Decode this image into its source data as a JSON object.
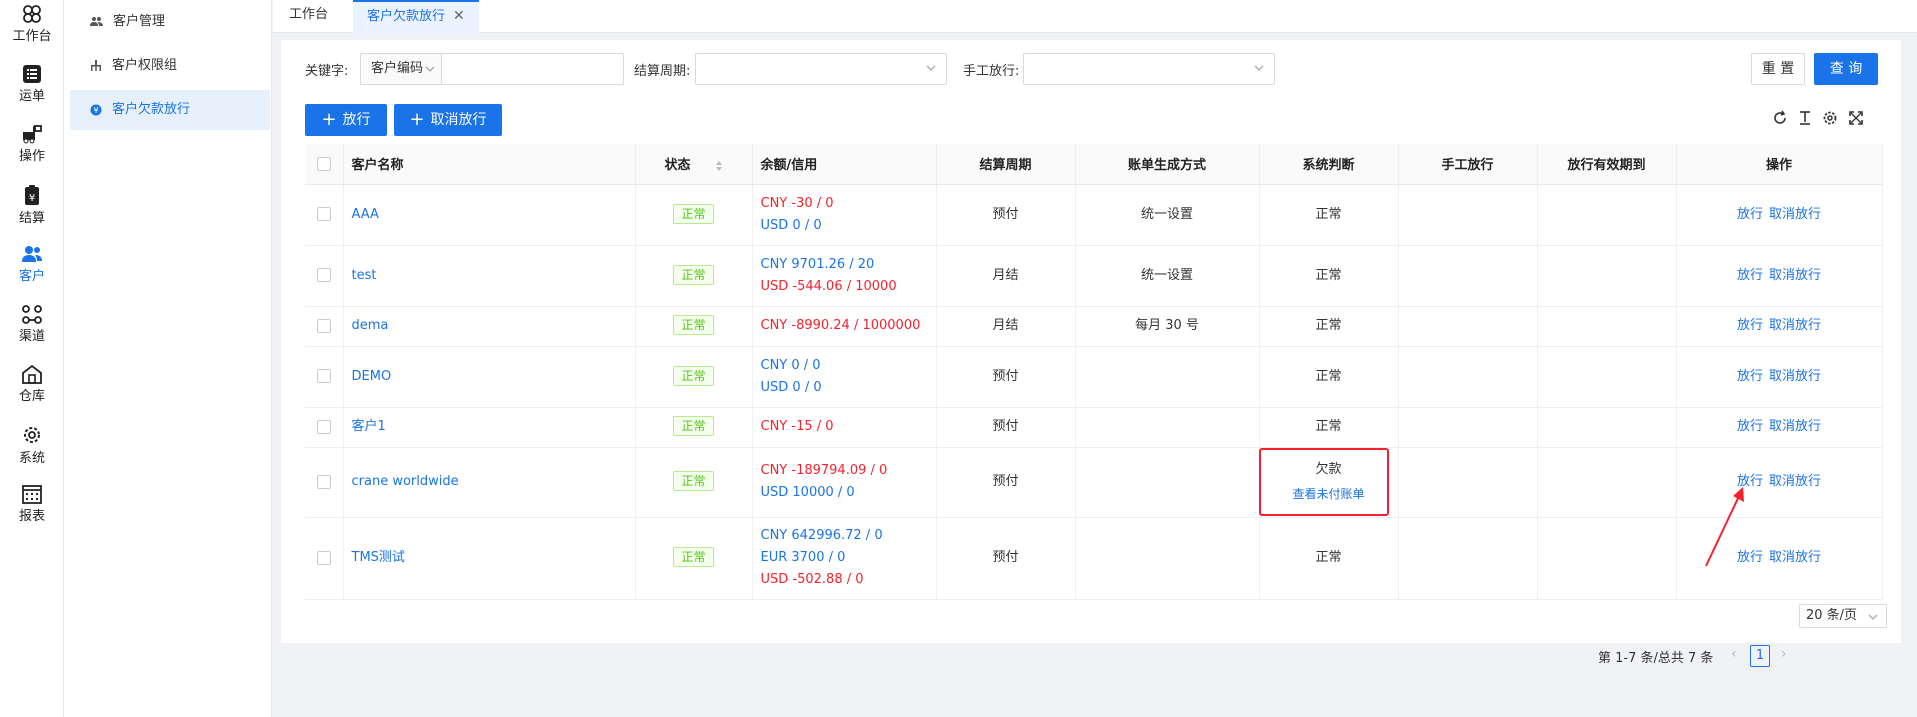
{
  "rail": {
    "items": [
      {
        "label": "工作台",
        "icon": "clover-icon"
      },
      {
        "label": "运单",
        "icon": "list-icon"
      },
      {
        "label": "操作",
        "icon": "forklift-icon"
      },
      {
        "label": "结算",
        "icon": "clipboard-yen-icon"
      },
      {
        "label": "客户",
        "icon": "users-icon"
      },
      {
        "label": "渠道",
        "icon": "channel-icon"
      },
      {
        "label": "仓库",
        "icon": "warehouse-icon"
      },
      {
        "label": "系统",
        "icon": "gear-icon"
      },
      {
        "label": "报表",
        "icon": "calendar-grid-icon"
      }
    ]
  },
  "subnav": {
    "items": [
      {
        "label": "客户管理"
      },
      {
        "label": "客户权限组"
      },
      {
        "label": "客户欠款放行"
      }
    ]
  },
  "tabs": [
    {
      "label": "工作台"
    },
    {
      "label": "客户欠款放行",
      "close": "✕"
    }
  ],
  "filters": {
    "keyword_label": "关键字:",
    "keyword_type": "客户编码",
    "keyword_value": "",
    "cycle_label": "结算周期:",
    "cycle_value": "",
    "manual_label": "手工放行:",
    "manual_value": ""
  },
  "buttons": {
    "reset": "重 置",
    "search": "查 询",
    "release": "放行",
    "cancel_release": "取消放行"
  },
  "table": {
    "headers": [
      "客户名称",
      "状态",
      "余额/信用",
      "结算周期",
      "账单生成方式",
      "系统判断",
      "手工放行",
      "放行有效期到",
      "操作"
    ],
    "rows": [
      {
        "name": "AAA",
        "status": "正常",
        "balances": [
          {
            "text": "CNY -30 / 0",
            "color": "red"
          },
          {
            "text": "USD 0 / 0",
            "color": "blue"
          }
        ],
        "cycle": "预付",
        "bill": "统一设置",
        "judge": "正常",
        "judge_link": "",
        "manual": "",
        "expiry": "",
        "op1": "放行",
        "op2": "取消放行"
      },
      {
        "name": "test",
        "status": "正常",
        "balances": [
          {
            "text": "CNY 9701.26 / 20",
            "color": "blue"
          },
          {
            "text": "USD -544.06 / 10000",
            "color": "red"
          }
        ],
        "cycle": "月结",
        "bill": "统一设置",
        "judge": "正常",
        "judge_link": "",
        "manual": "",
        "expiry": "",
        "op1": "放行",
        "op2": "取消放行"
      },
      {
        "name": "dema",
        "status": "正常",
        "balances": [
          {
            "text": "CNY -8990.24 / 1000000",
            "color": "red"
          }
        ],
        "cycle": "月结",
        "bill": "每月 30 号",
        "judge": "正常",
        "judge_link": "",
        "manual": "",
        "expiry": "",
        "op1": "放行",
        "op2": "取消放行"
      },
      {
        "name": "DEMO",
        "status": "正常",
        "balances": [
          {
            "text": "CNY 0 / 0",
            "color": "blue"
          },
          {
            "text": "USD 0 / 0",
            "color": "blue"
          }
        ],
        "cycle": "预付",
        "bill": "",
        "judge": "正常",
        "judge_link": "",
        "manual": "",
        "expiry": "",
        "op1": "放行",
        "op2": "取消放行"
      },
      {
        "name": "客户1",
        "status": "正常",
        "balances": [
          {
            "text": "CNY -15 / 0",
            "color": "red"
          }
        ],
        "cycle": "预付",
        "bill": "",
        "judge": "正常",
        "judge_link": "",
        "manual": "",
        "expiry": "",
        "op1": "放行",
        "op2": "取消放行"
      },
      {
        "name": "crane worldwide",
        "status": "正常",
        "balances": [
          {
            "text": "CNY -189794.09 / 0",
            "color": "red"
          },
          {
            "text": "USD 10000 / 0",
            "color": "blue"
          }
        ],
        "cycle": "预付",
        "bill": "",
        "judge": "欠款",
        "judge_link": "查看未付账单",
        "manual": "",
        "expiry": "",
        "op1": "放行",
        "op2": "取消放行"
      },
      {
        "name": "TMS测试",
        "status": "正常",
        "balances": [
          {
            "text": "CNY 642996.72 / 0",
            "color": "blue"
          },
          {
            "text": "EUR 3700 / 0",
            "color": "blue"
          },
          {
            "text": "USD -502.88 / 0",
            "color": "red"
          }
        ],
        "cycle": "预付",
        "bill": "",
        "judge": "正常",
        "judge_link": "",
        "manual": "",
        "expiry": "",
        "op1": "放行",
        "op2": "取消放行"
      }
    ]
  },
  "pagination": {
    "info": "第 1-7 条/总共 7 条",
    "current": "1",
    "page_size": "20 条/页"
  },
  "colors": {
    "primary": "#1a73e8",
    "danger": "#f5222d",
    "success": "#52c41a"
  }
}
